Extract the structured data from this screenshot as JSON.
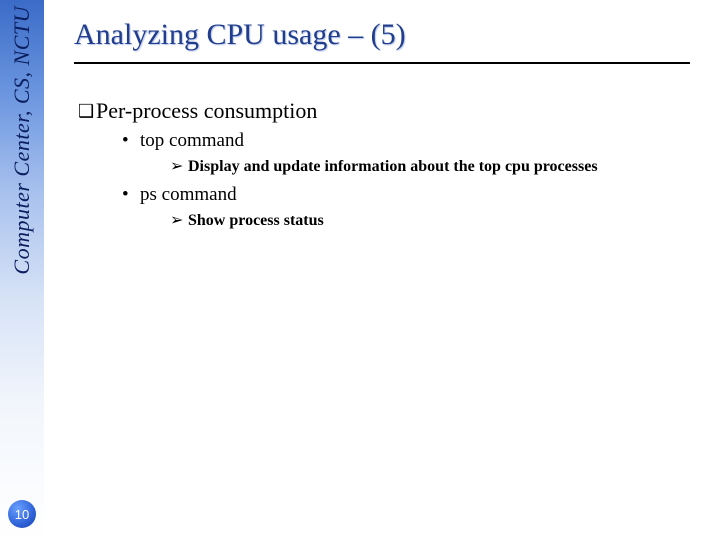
{
  "sidebar": {
    "org_text": "Computer Center, CS, NCTU"
  },
  "page": {
    "number": "10"
  },
  "title": "Analyzing CPU usage – (5)",
  "bullets": {
    "level1": {
      "marker": "❑",
      "text": "Per-process consumption"
    },
    "items": [
      {
        "l2_marker": "•",
        "l2_text": "top command",
        "l3_marker": "➢",
        "l3_text": "Display and update information about the top cpu processes"
      },
      {
        "l2_marker": "•",
        "l2_text": "ps command",
        "l3_marker": "➢",
        "l3_text": "Show process status"
      }
    ]
  }
}
